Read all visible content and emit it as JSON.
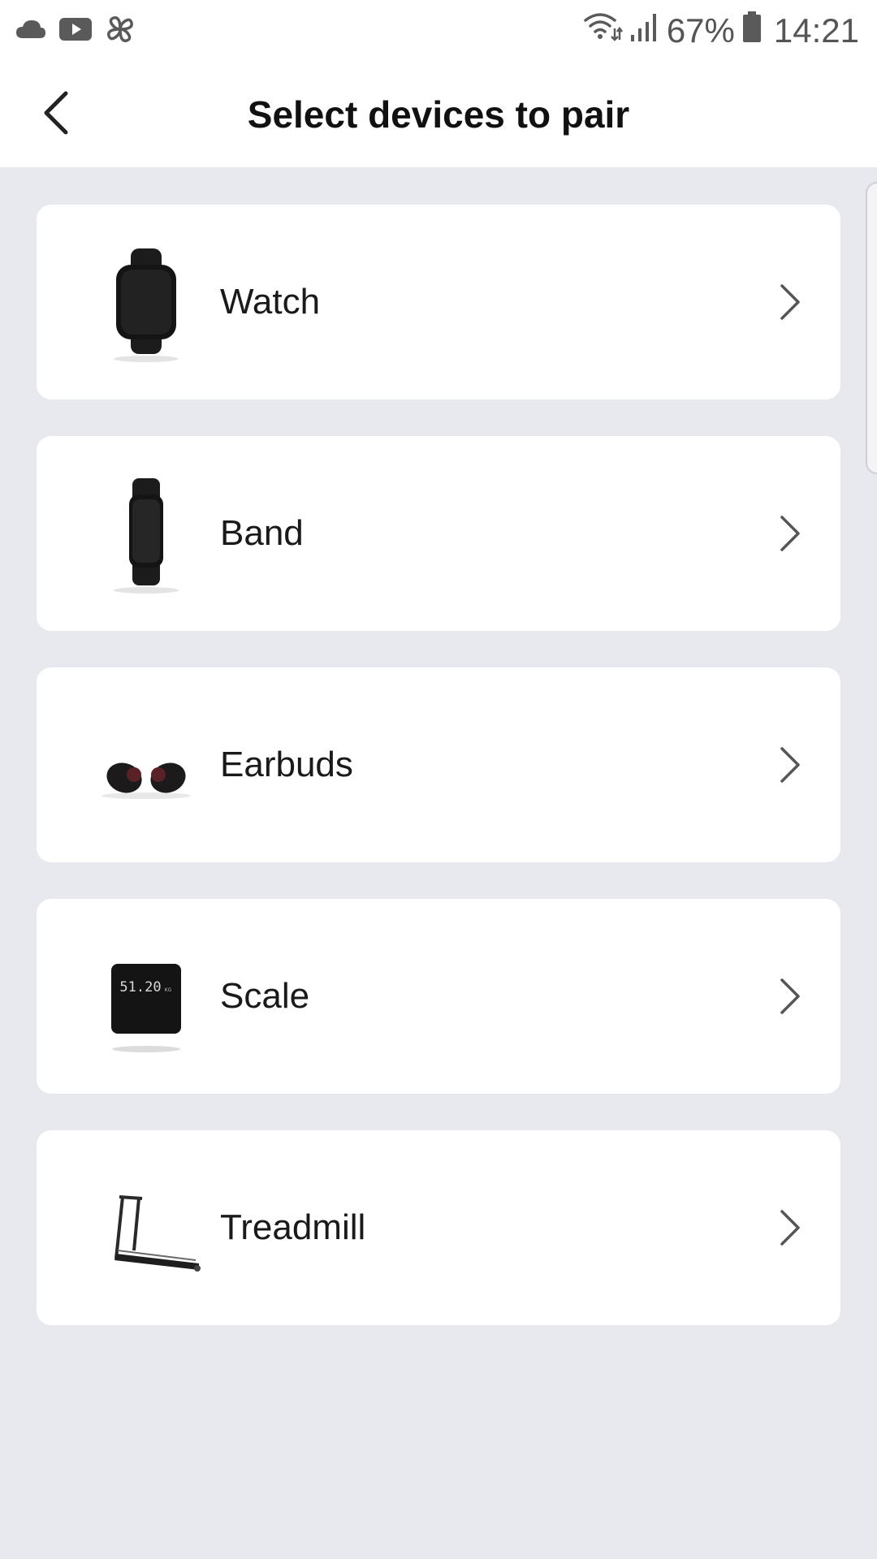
{
  "status_bar": {
    "battery": "67%",
    "time": "14:21",
    "icons": [
      "cloud-icon",
      "youtube-icon",
      "pinwheel-icon",
      "wifi-icon",
      "signal-icon",
      "battery-icon"
    ]
  },
  "header": {
    "title": "Select devices to pair",
    "back_icon": "back-arrow-icon"
  },
  "devices": [
    {
      "label": "Watch",
      "icon": "watch-icon"
    },
    {
      "label": "Band",
      "icon": "band-icon"
    },
    {
      "label": "Earbuds",
      "icon": "earbuds-icon"
    },
    {
      "label": "Scale",
      "icon": "scale-icon",
      "display_text": "51.20",
      "unit_text": "KG"
    },
    {
      "label": "Treadmill",
      "icon": "treadmill-icon"
    }
  ],
  "colors": {
    "background": "#e8e9ee",
    "card": "#ffffff",
    "text": "#1a1a1a",
    "chevron": "#555555"
  }
}
